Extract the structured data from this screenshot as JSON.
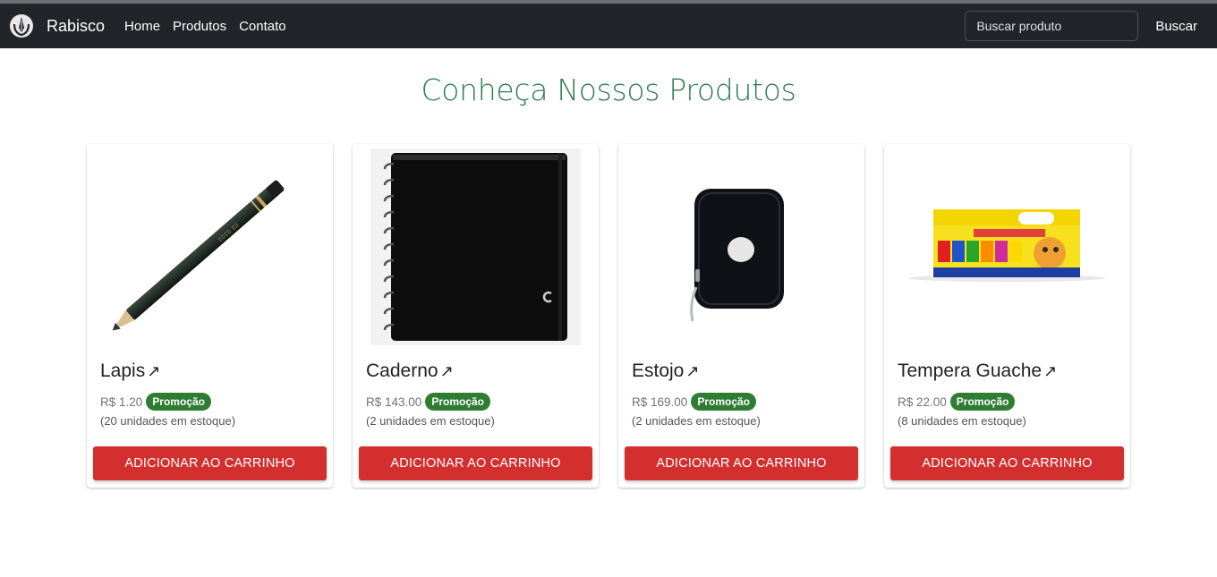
{
  "navbar": {
    "brand": "Rabisco",
    "links": [
      "Home",
      "Produtos",
      "Contato"
    ],
    "search_placeholder": "Buscar produto",
    "search_button": "Buscar"
  },
  "page_title": "Conheça Nossos Produtos",
  "products": [
    {
      "name": "Lapis",
      "price": "R$ 1.20",
      "badge": "Promoção",
      "stock": "(20 unidades em estoque)",
      "button": "ADICIONAR AO CARRINHO",
      "image": "pencil-image"
    },
    {
      "name": "Caderno",
      "price": "R$ 143.00",
      "badge": "Promoção",
      "stock": "(2 unidades em estoque)",
      "button": "ADICIONAR AO CARRINHO",
      "image": "notebook-image"
    },
    {
      "name": "Estojo",
      "price": "R$ 169.00",
      "badge": "Promoção",
      "stock": "(2 unidades em estoque)",
      "button": "ADICIONAR AO CARRINHO",
      "image": "pencil-case-image"
    },
    {
      "name": "Tempera Guache",
      "price": "R$ 22.00",
      "badge": "Promoção",
      "stock": "(8 unidades em estoque)",
      "button": "ADICIONAR AO CARRINHO",
      "image": "gouache-paint-image"
    }
  ],
  "icons": {
    "logo": "pencil-logo-icon",
    "title_link": "arrow-up-right-icon"
  },
  "colors": {
    "navbar": "#212529",
    "title": "#2e7d52",
    "badge": "#2e7d32",
    "button": "#d32f2f"
  }
}
